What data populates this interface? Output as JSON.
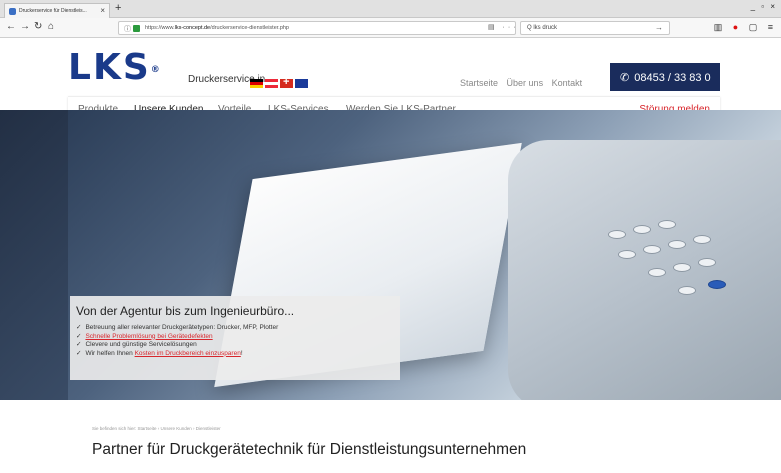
{
  "browser": {
    "tab_title": "Druckerservice für Dienstleis...",
    "new_tab": "+",
    "tab_close": "×",
    "window_controls": "_ ▫ ×",
    "url_prefix": "https://www.",
    "url_host": "lks-concept.de",
    "url_path": "/druckerservice-dienstleister.php",
    "url_icons": "▤ ··· ♡ ☆",
    "search_value": "Q  lks druck",
    "search_go": "→"
  },
  "site": {
    "logo_text": "LKS",
    "logo_mark": "®",
    "tagline": "Druckerservice in",
    "top_links": [
      "Startseite",
      "Über uns",
      "Kontakt"
    ],
    "phone": "08453 / 33 83 0"
  },
  "nav": {
    "items": [
      "Produkte",
      "Unsere Kunden",
      "Vorteile",
      "LKS-Services",
      "Werden Sie LKS-Partner"
    ],
    "active_index": 1,
    "stoerung": "Störung melden"
  },
  "hero": {
    "title": "Von der Agentur bis zum Ingenieurbüro...",
    "bullets": [
      {
        "text": "Betreuung aller relevanter Druckgerätetypen: Drucker, MFP, Plotter",
        "link": false
      },
      {
        "text": "Schnelle Problemlösung bei Gerätedefekten",
        "link": true
      },
      {
        "text": "Clevere und günstige Servicelösungen",
        "link": false
      },
      {
        "text_pre": "Wir helfen Ihnen ",
        "text_link": "Kosten im Druckbereich einzusparen",
        "text_post": "!"
      }
    ]
  },
  "content": {
    "breadcrumb": "Sie befinden sich hier: Startseite › Unsere Kunden › Dienstleister",
    "title": "Partner für Druckgerätetechnik für Dienstleistungsunternehmen"
  },
  "colors": {
    "brand_blue": "#1a3a8a",
    "phone_bg": "#1a2c5c",
    "accent_red": "#d8262c"
  }
}
